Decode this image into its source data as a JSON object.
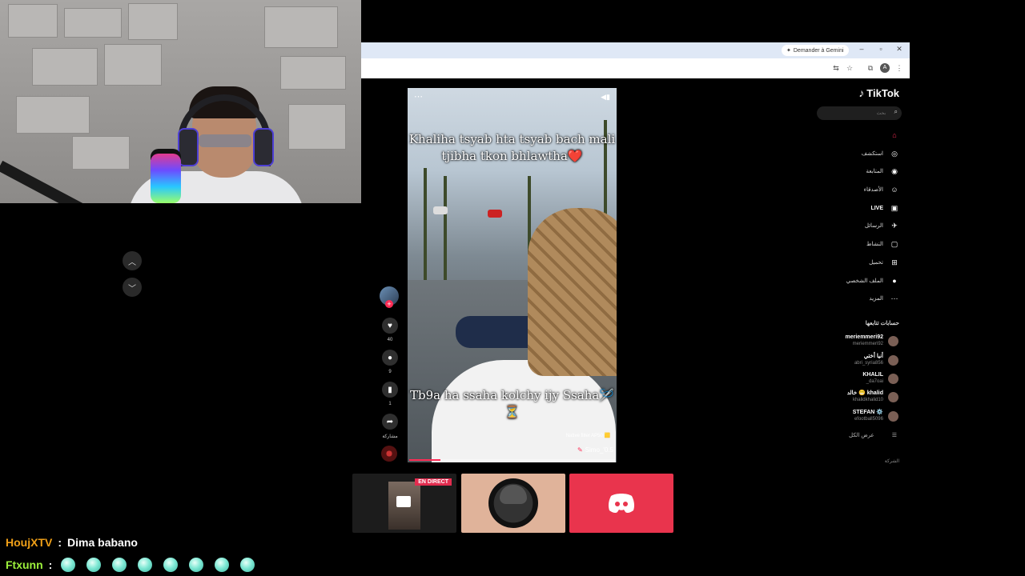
{
  "browser": {
    "gemini_button": "Demander à Gemini",
    "controls": {
      "minimize": "–",
      "restore": "▫",
      "close": "✕"
    }
  },
  "tiktok": {
    "logo": "TikTok",
    "search_placeholder": "بحث",
    "nav": [
      {
        "label": "",
        "icon": "home-icon",
        "glyph": "⌂"
      },
      {
        "label": "استكشف",
        "icon": "compass-icon",
        "glyph": "◎"
      },
      {
        "label": "المتابعة",
        "icon": "following-icon",
        "glyph": "◉"
      },
      {
        "label": "الأصدقاء",
        "icon": "friends-icon",
        "glyph": "☺"
      },
      {
        "label": "LIVE",
        "icon": "live-icon",
        "glyph": "▣"
      },
      {
        "label": "الرسائل",
        "icon": "messages-icon",
        "glyph": "✈"
      },
      {
        "label": "النشاط",
        "icon": "activity-icon",
        "glyph": "▢"
      },
      {
        "label": "تحميل",
        "icon": "upload-icon",
        "glyph": "⊞"
      },
      {
        "label": "الملف الشخصي",
        "icon": "profile-icon",
        "glyph": "●"
      },
      {
        "label": "المزيد",
        "icon": "more-icon",
        "glyph": "⋯"
      }
    ],
    "following_title": "حسابات تتابعها",
    "accounts": [
      {
        "name": "meriemmeri92",
        "handle": "meriemmeri92"
      },
      {
        "name": "أنيا أختي",
        "handle": "abri_syria856"
      },
      {
        "name": "KHALIL",
        "handle": "_da7oai"
      },
      {
        "name": "خالد 😁 khalid",
        "handle": "khalidkhalid10"
      },
      {
        "name": "STEFAN ⚙️",
        "handle": "efootball5096"
      }
    ],
    "see_all": "عرض الكل",
    "company": "الشركة",
    "video": {
      "caption_top": "Khaliha tsyab hta tsyab bach mali tjibha  tkon bhlawtha❤️",
      "caption_bottom": "Tb9a ha ssaha kolchy ijy Ssaha🪡⏳",
      "filter_label": "Native filter AP50 🟨",
      "author": "Simo_'0.5",
      "progress_pct": 15
    },
    "actions": {
      "likes": "40",
      "comments": "9",
      "saves": "1",
      "share": "مشاركة"
    }
  },
  "stream": {
    "live_badge": "EN DIRECT",
    "chat": [
      {
        "user": "HoujXTV",
        "user_color": "#f0a018",
        "separator": ":",
        "message": "Dima babano",
        "gems": 0
      },
      {
        "user": "Ftxunn",
        "user_color": "#9cf03c",
        "separator": ":",
        "message": "",
        "gems": 8
      }
    ]
  }
}
